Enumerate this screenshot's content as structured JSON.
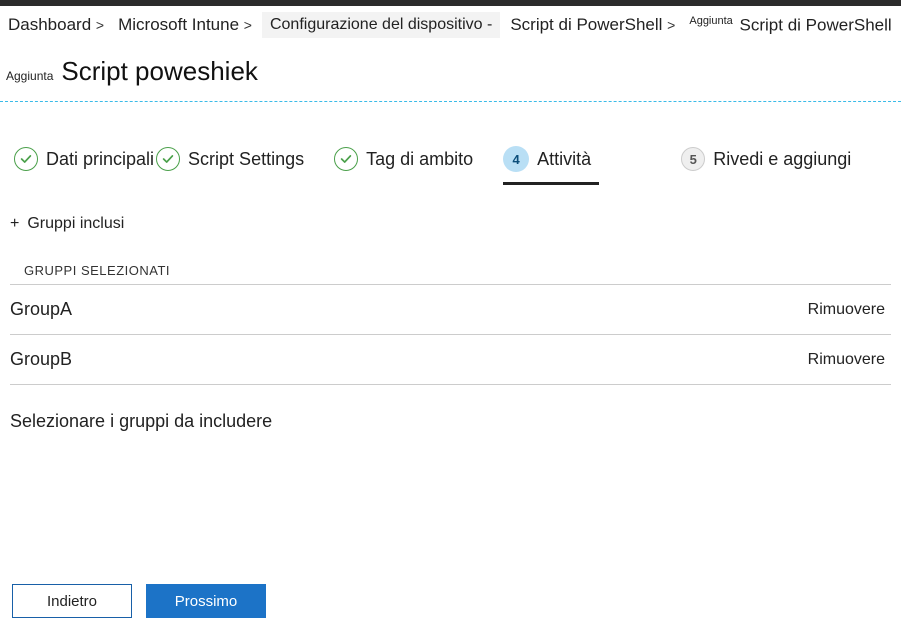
{
  "breadcrumb": {
    "items": [
      {
        "label": "Dashboard",
        "sep": "&gt;"
      },
      {
        "label": "Microsoft Intune",
        "sep": "&gt;"
      },
      {
        "label": "Configurazione del dispositivo -",
        "highlight": true
      },
      {
        "label": "Script di PowerShell",
        "sep": "&gt;"
      },
      {
        "prefix": "Aggiunta",
        "label": "Script di PowerShell"
      }
    ]
  },
  "title": {
    "prefix": "Aggiunta",
    "text": "Script poweshiek"
  },
  "steps": [
    {
      "state": "done",
      "label": "Dati principali"
    },
    {
      "state": "done",
      "label": "Script Settings"
    },
    {
      "state": "done",
      "label": "Tag di ambito"
    },
    {
      "state": "current",
      "num": "4",
      "label": "Attività"
    },
    {
      "state": "pending",
      "num": "5",
      "label": "Rivedi e aggiungi"
    }
  ],
  "section": {
    "add_label": "Gruppi inclusi",
    "subheader": "Gruppi selezionati",
    "groups": [
      {
        "name": "GroupA",
        "remove": "Rimuovere"
      },
      {
        "name": "GroupB",
        "remove": "Rimuovere"
      }
    ],
    "hint": "Selezionare i gruppi da includere"
  },
  "footer": {
    "back": "Indietro",
    "next": "Prossimo"
  }
}
